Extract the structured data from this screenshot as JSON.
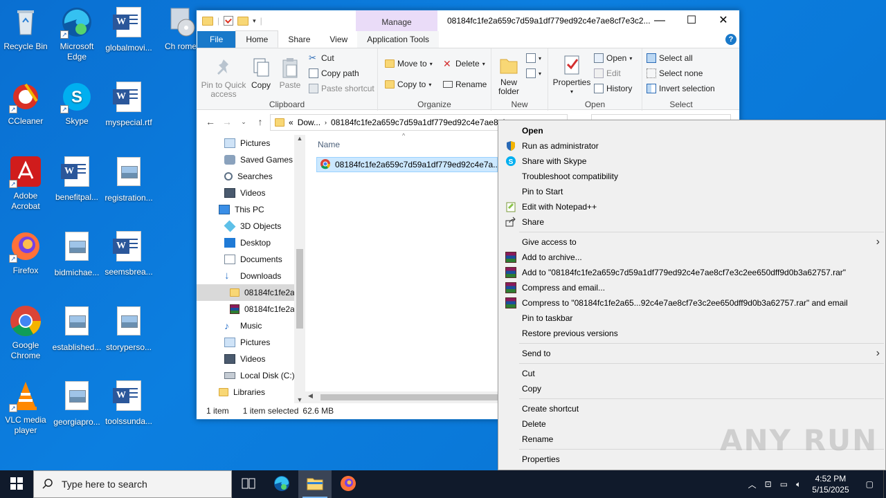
{
  "desktop": {
    "icons": [
      {
        "label": "Recycle Bin"
      },
      {
        "label": "Microsoft Edge"
      },
      {
        "label": "globalmovi..."
      },
      {
        "label": "Ch rome"
      },
      {
        "label": "CCleaner"
      },
      {
        "label": "Skype"
      },
      {
        "label": "myspecial.rtf"
      },
      {
        "label": "Adobe Acrobat"
      },
      {
        "label": "benefitpal..."
      },
      {
        "label": "registration..."
      },
      {
        "label": "Firefox"
      },
      {
        "label": "bidmichae..."
      },
      {
        "label": "seemsbrea..."
      },
      {
        "label": "Google Chrome"
      },
      {
        "label": "established..."
      },
      {
        "label": "storyperso..."
      },
      {
        "label": "VLC media player"
      },
      {
        "label": "georgiapro..."
      },
      {
        "label": "toolssunda..."
      }
    ]
  },
  "explorer": {
    "title": "08184fc1fe2a659c7d59a1df779ed92c4e7ae8cf7e3c2...",
    "manage_tab": "Manage",
    "tabs": {
      "file": "File",
      "home": "Home",
      "share": "Share",
      "view": "View",
      "app_tools": "Application Tools"
    },
    "ribbon": {
      "clipboard": {
        "pin": "Pin to Quick access",
        "copy": "Copy",
        "paste": "Paste",
        "cut": "Cut",
        "copy_path": "Copy path",
        "paste_shortcut": "Paste shortcut",
        "label": "Clipboard"
      },
      "organize": {
        "move_to": "Move to",
        "copy_to": "Copy to",
        "delete": "Delete",
        "rename": "Rename",
        "label": "Organize"
      },
      "new": {
        "new_folder": "New folder",
        "label": "New"
      },
      "open": {
        "properties": "Properties",
        "open": "Open",
        "edit": "Edit",
        "history": "History",
        "label": "Open"
      },
      "select": {
        "select_all": "Select all",
        "select_none": "Select none",
        "invert": "Invert selection",
        "label": "Select"
      }
    },
    "address": {
      "prefix": "«",
      "crumb1": "Dow...",
      "crumb2": "08184fc1fe2a659c7d59a1df779ed92c4e7ae8cf"
    },
    "nav_items": [
      {
        "label": "Pictures"
      },
      {
        "label": "Saved Games"
      },
      {
        "label": "Searches"
      },
      {
        "label": "Videos"
      },
      {
        "label": "This PC"
      },
      {
        "label": "3D Objects"
      },
      {
        "label": "Desktop"
      },
      {
        "label": "Documents"
      },
      {
        "label": "Downloads"
      },
      {
        "label": "08184fc1fe2a"
      },
      {
        "label": "08184fc1fe2a"
      },
      {
        "label": "Music"
      },
      {
        "label": "Pictures"
      },
      {
        "label": "Videos"
      },
      {
        "label": "Local Disk (C:)"
      },
      {
        "label": "Libraries"
      }
    ],
    "column_name": "Name",
    "file_name": "08184fc1fe2a659c7d59a1df779ed92c4e7a...",
    "status": {
      "items": "1 item",
      "selected": "1 item selected",
      "size": "62.6 MB"
    }
  },
  "context_menu": {
    "items": [
      {
        "label": "Open",
        "icon": "none"
      },
      {
        "label": "Run as administrator",
        "icon": "shield-icon"
      },
      {
        "label": "Share with Skype",
        "icon": "skype-icon"
      },
      {
        "label": "Troubleshoot compatibility",
        "icon": "none"
      },
      {
        "label": "Pin to Start",
        "icon": "none"
      },
      {
        "label": "Edit with Notepad++",
        "icon": "notepadpp-icon"
      },
      {
        "label": "Share",
        "icon": "share-icon"
      },
      {
        "label": "Give access to",
        "icon": "none"
      },
      {
        "label": "Add to archive...",
        "icon": "winrar-icon"
      },
      {
        "label": "Add to \"08184fc1fe2a659c7d59a1df779ed92c4e7ae8cf7e3c2ee650dff9d0b3a62757.rar\"",
        "icon": "winrar-icon"
      },
      {
        "label": "Compress and email...",
        "icon": "winrar-icon"
      },
      {
        "label": "Compress to \"08184fc1fe2a65...92c4e7ae8cf7e3c2ee650dff9d0b3a62757.rar\" and email",
        "icon": "winrar-icon"
      },
      {
        "label": "Pin to taskbar",
        "icon": "none"
      },
      {
        "label": "Restore previous versions",
        "icon": "none"
      },
      {
        "label": "Send to",
        "icon": "none"
      },
      {
        "label": "Cut",
        "icon": "none"
      },
      {
        "label": "Copy",
        "icon": "none"
      },
      {
        "label": "Create shortcut",
        "icon": "none"
      },
      {
        "label": "Delete",
        "icon": "none"
      },
      {
        "label": "Rename",
        "icon": "none"
      },
      {
        "label": "Properties",
        "icon": "none"
      }
    ]
  },
  "watermark": "ANY RUN",
  "taskbar": {
    "search_placeholder": "Type here to search",
    "time": "4:52 PM",
    "date": "5/15/2025"
  },
  "colors": {
    "accent": "#1979ca",
    "desktop": "#0a78d8",
    "selection": "#cce8ff",
    "taskbar": "#101a2b"
  }
}
